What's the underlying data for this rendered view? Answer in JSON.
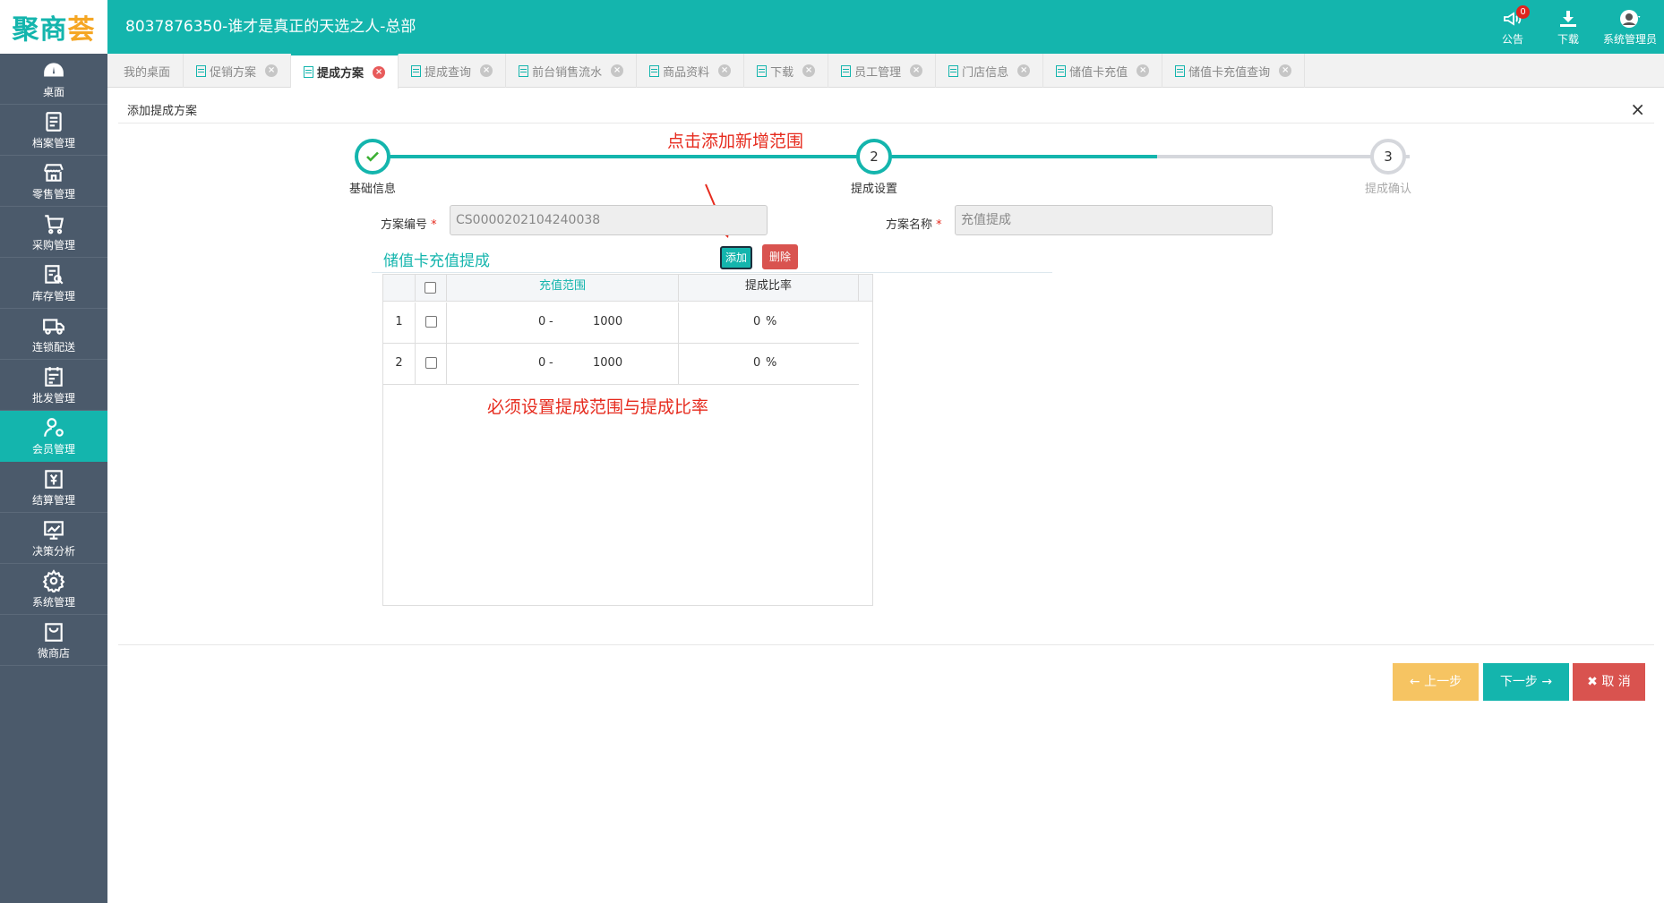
{
  "header": {
    "logo_main": "聚商",
    "logo_accent": "荟",
    "title": "8037876350-谁才是真正的天选之人-总部",
    "notice_label": "公告",
    "notice_count": "0",
    "download_label": "下载",
    "user_label": "系统管理员"
  },
  "sidebar": {
    "items": [
      {
        "label": "桌面",
        "icon": "dashboard-icon"
      },
      {
        "label": "档案管理",
        "icon": "file-icon"
      },
      {
        "label": "零售管理",
        "icon": "store-icon"
      },
      {
        "label": "采购管理",
        "icon": "cart-icon"
      },
      {
        "label": "库存管理",
        "icon": "inventory-icon"
      },
      {
        "label": "连锁配送",
        "icon": "truck-icon"
      },
      {
        "label": "批发管理",
        "icon": "wholesale-icon"
      },
      {
        "label": "会员管理",
        "icon": "member-icon"
      },
      {
        "label": "结算管理",
        "icon": "settlement-icon"
      },
      {
        "label": "决策分析",
        "icon": "analysis-icon"
      },
      {
        "label": "系统管理",
        "icon": "gear-icon"
      },
      {
        "label": "微商店",
        "icon": "shop-bag-icon"
      }
    ],
    "active_index": 7
  },
  "tabs": [
    {
      "label": "我的桌面",
      "closable": false
    },
    {
      "label": "促销方案",
      "closable": true
    },
    {
      "label": "提成方案",
      "closable": true,
      "active": true
    },
    {
      "label": "提成查询",
      "closable": true
    },
    {
      "label": "前台销售流水",
      "closable": true
    },
    {
      "label": "商品资料",
      "closable": true
    },
    {
      "label": "下载",
      "closable": true
    },
    {
      "label": "员工管理",
      "closable": true
    },
    {
      "label": "门店信息",
      "closable": true
    },
    {
      "label": "储值卡充值",
      "closable": true
    },
    {
      "label": "储值卡充值查询",
      "closable": true
    }
  ],
  "panel": {
    "title": "添加提成方案",
    "close_symbol": "×"
  },
  "steps": [
    {
      "number": "1",
      "label": "基础信息",
      "state": "done"
    },
    {
      "number": "2",
      "label": "提成设置",
      "state": "current"
    },
    {
      "number": "3",
      "label": "提成确认",
      "state": "pending"
    }
  ],
  "annotations": {
    "top": "点击添加新增范围",
    "bottom": "必须设置提成范围与提成比率"
  },
  "form": {
    "code_label": "方案编号",
    "code_value": "CS0000202104240038",
    "name_label": "方案名称",
    "name_value": "充值提成",
    "required_mark": "*"
  },
  "section": {
    "title": "储值卡充值提成",
    "add_label": "添加",
    "delete_label": "删除"
  },
  "grid": {
    "columns": [
      "充值范围",
      "提成比率"
    ],
    "rows": [
      {
        "num": "1",
        "from": "0",
        "dash": "-",
        "to": "1000",
        "rate": "0",
        "unit": "%"
      },
      {
        "num": "2",
        "from": "0",
        "dash": "-",
        "to": "1000",
        "rate": "0",
        "unit": "%"
      }
    ]
  },
  "footer": {
    "prev_label": "上一步",
    "next_label": "下一步",
    "cancel_label": "取 消"
  },
  "colors": {
    "primary": "#14b5ad",
    "sidebar": "#4b5a6b",
    "danger": "#d9534f",
    "warning": "#f6c462",
    "annotation": "#e62b1e"
  }
}
